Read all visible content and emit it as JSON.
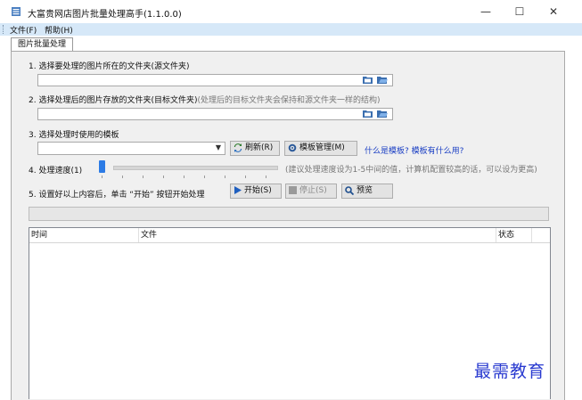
{
  "window": {
    "title": "大富贵网店图片批量处理高手(1.1.0.0)",
    "minimize": "—",
    "maximize": "☐",
    "close": "✕"
  },
  "menu": [
    "文件(F)",
    "帮助(H)"
  ],
  "tab": "图片批量处理",
  "step1": {
    "label": "1. 选择要处理的图片所在的文件夹(源文件夹)",
    "value": ""
  },
  "step2": {
    "label": "2. 选择处理后的图片存放的文件夹(目标文件夹)",
    "hint": "(处理后的目标文件夹会保持和源文件夹一样的结构)",
    "value": ""
  },
  "step3": {
    "label": "3. 选择处理时使用的模板",
    "value": "",
    "refresh": "刷新(R)",
    "manage": "模板管理(M)",
    "help_link": "什么是模板? 模板有什么用?"
  },
  "step4": {
    "label": "4. 处理速度(1)",
    "hint": "(建议处理速度设为1-5中间的值，计算机配置较高的话，可以设为更高)",
    "slider_value": 1
  },
  "step5": {
    "label": "5. 设置好以上内容后，单击 “开始” 按钮开始处理",
    "start": "开始(S)",
    "stop": "停止(S)",
    "preview": "预览"
  },
  "log": {
    "columns": [
      "时间",
      "文件",
      "状态"
    ],
    "rows": []
  },
  "watermark": "最需教育",
  "colors": {
    "accent": "#1b3fc4",
    "menubar": "#d6e8f8",
    "slider": "#2c7be5"
  }
}
